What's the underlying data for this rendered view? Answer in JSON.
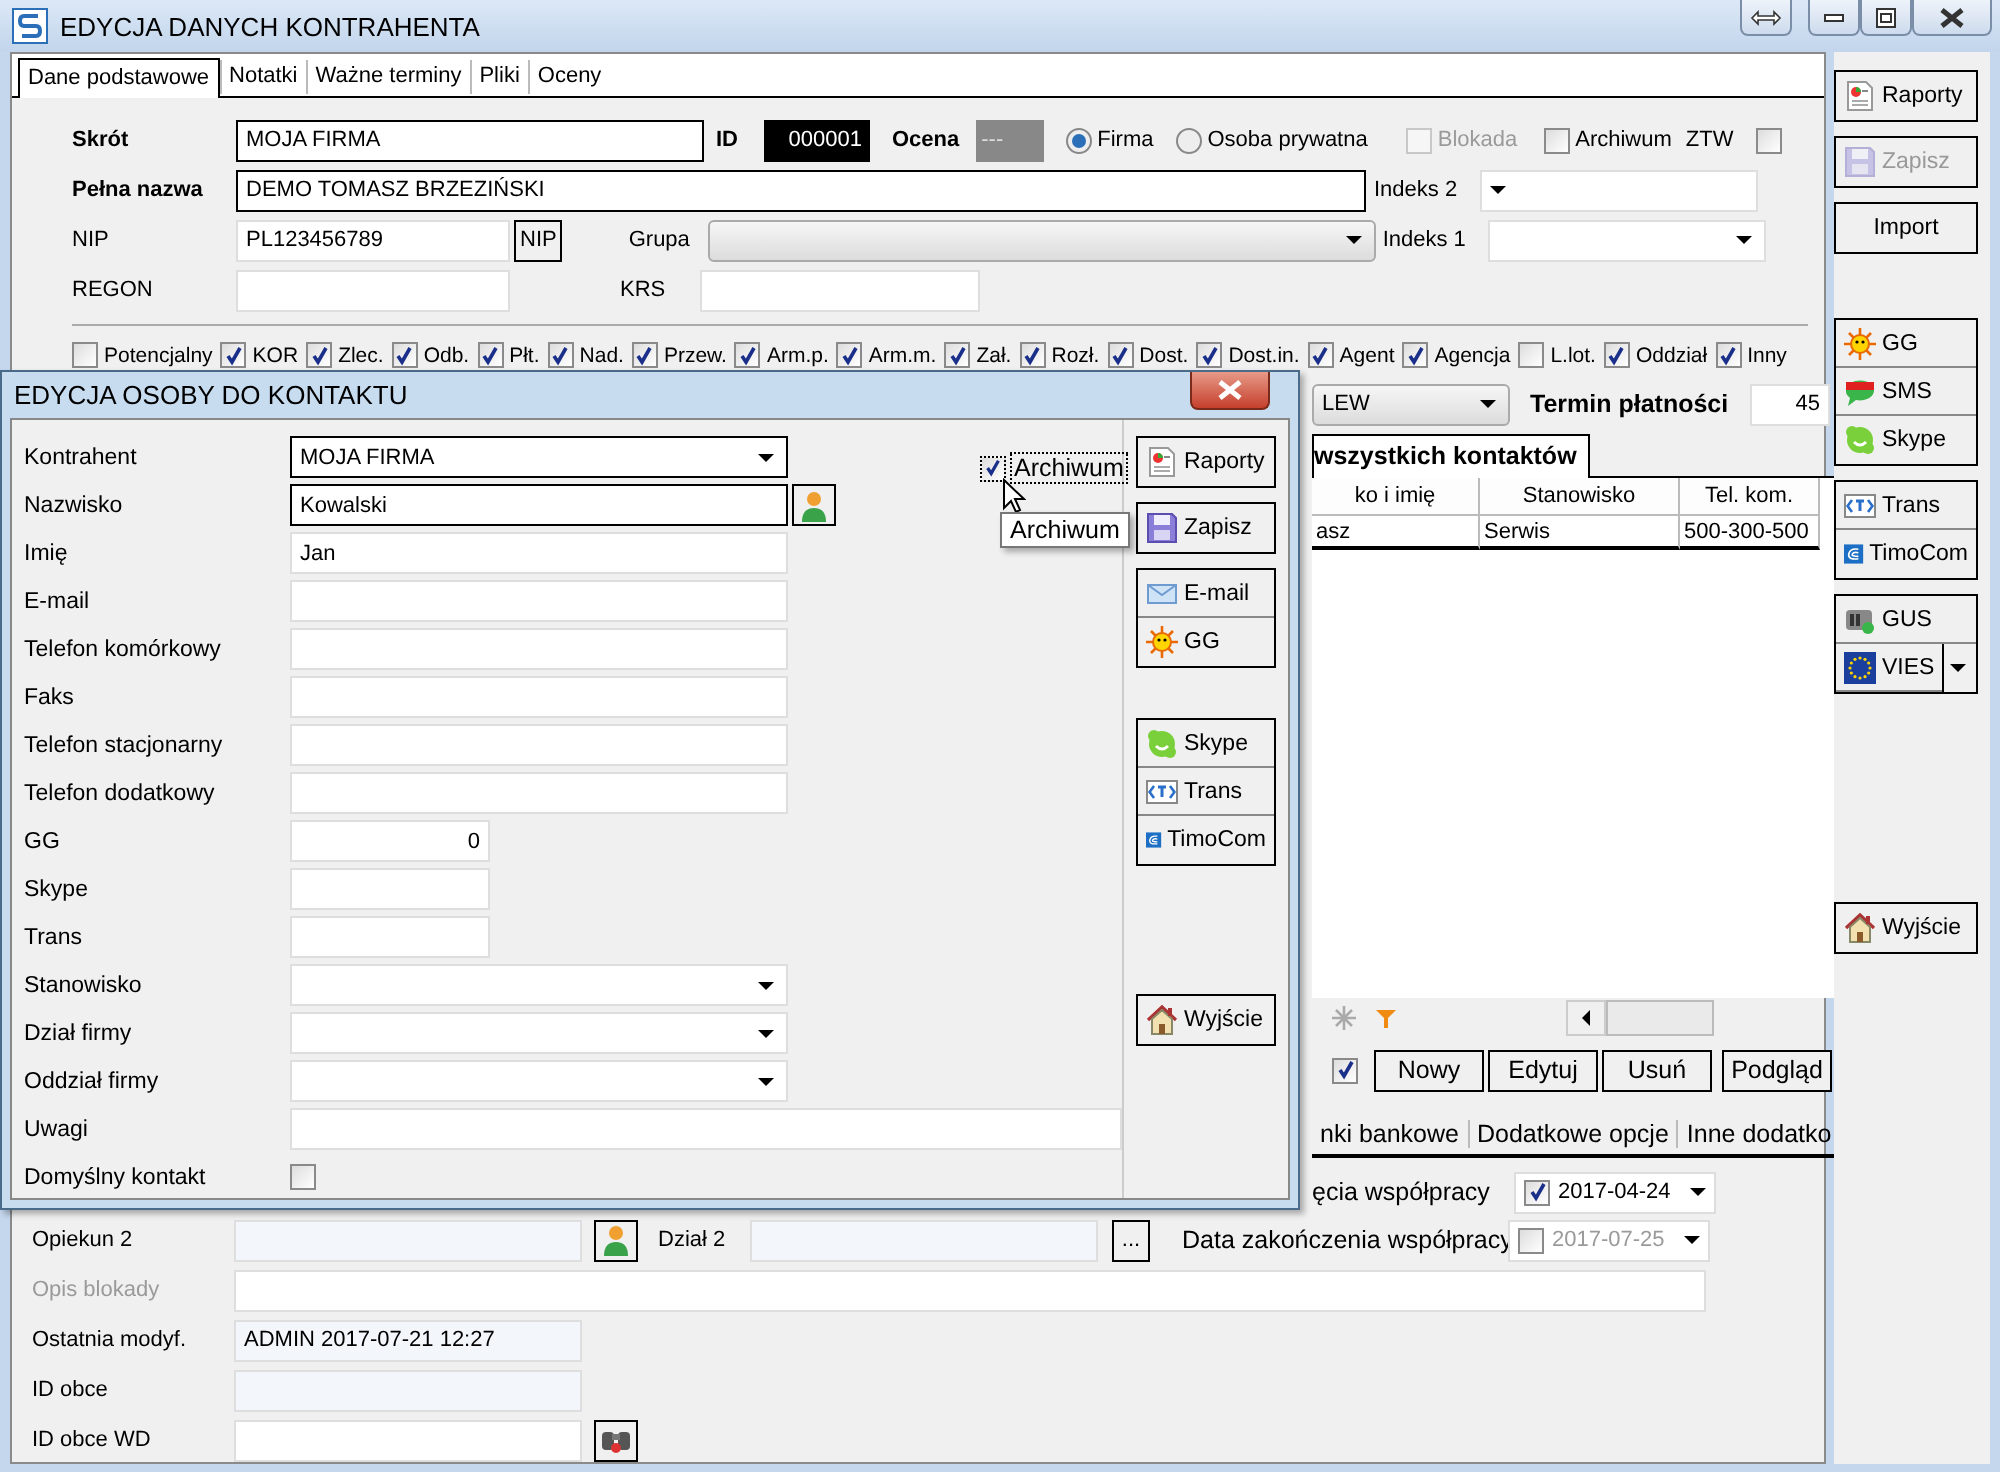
{
  "window": {
    "title": "EDYCJA DANYCH KONTRAHENTA"
  },
  "tabs": [
    {
      "label": "Dane podstawowe",
      "selected": true
    },
    {
      "label": "Notatki",
      "selected": false
    },
    {
      "label": "Ważne terminy",
      "selected": false
    },
    {
      "label": "Pliki",
      "selected": false
    },
    {
      "label": "Oceny",
      "selected": false
    }
  ],
  "header": {
    "short_name": {
      "label": "Skrót",
      "value": "MOJA FIRMA",
      "required": true
    },
    "id": {
      "label": "ID",
      "value": "000001"
    },
    "rating": {
      "label": "Ocena",
      "value": "---"
    },
    "entity_type": [
      {
        "label": "Firma",
        "selected": true
      },
      {
        "label": "Osoba prywatna",
        "selected": false
      }
    ],
    "flags": [
      {
        "label": "Blokada",
        "checked": false,
        "disabled": true
      },
      {
        "label": "Archiwum",
        "checked": false,
        "disabled": false
      }
    ],
    "ztw": {
      "label": "ZTW",
      "checked": false
    },
    "full_name": {
      "label": "Pełna nazwa",
      "value": "DEMO TOMASZ BRZEZIŃSKI",
      "required": true
    },
    "index2": {
      "label": "Indeks 2"
    },
    "nip": {
      "label": "NIP",
      "value": "PL123456789",
      "button": "NIP"
    },
    "group": {
      "label": "Grupa"
    },
    "index1": {
      "label": "Indeks 1"
    },
    "regon": {
      "label": "REGON"
    },
    "krs": {
      "label": "KRS"
    }
  },
  "roles": [
    {
      "label": "Potencjalny",
      "checked": false
    },
    {
      "label": "KOR",
      "checked": true
    },
    {
      "label": "Zlec.",
      "checked": true
    },
    {
      "label": "Odb.",
      "checked": true
    },
    {
      "label": "Płt.",
      "checked": true
    },
    {
      "label": "Nad.",
      "checked": true
    },
    {
      "label": "Przew.",
      "checked": true
    },
    {
      "label": "Arm.p.",
      "checked": true
    },
    {
      "label": "Arm.m.",
      "checked": true
    },
    {
      "label": "Zał.",
      "checked": true
    },
    {
      "label": "Rozł.",
      "checked": true
    },
    {
      "label": "Dost.",
      "checked": true
    },
    {
      "label": "Dost.in.",
      "checked": true
    },
    {
      "label": "Agent",
      "checked": true
    },
    {
      "label": "Agencja",
      "checked": true
    },
    {
      "label": "L.lot.",
      "checked": false
    },
    {
      "label": "Oddział",
      "checked": true
    },
    {
      "label": "Inny",
      "checked": true
    }
  ],
  "payment": {
    "method": "LEW",
    "term_label": "Termin płatności",
    "term": "45"
  },
  "contacts_tab": "wszystkich kontaktów",
  "contacts_table": {
    "columns": [
      "ko i imię",
      "Stanowisko",
      "Tel. kom."
    ],
    "rows": [
      [
        "asz",
        "Serwis",
        "500-300-500"
      ]
    ]
  },
  "contacts_filter": {
    "checked": true
  },
  "contact_buttons": [
    "Nowy",
    "Edytuj",
    "Usuń",
    "Podgląd"
  ],
  "lower_tabs": [
    "nki bankowe",
    "Dodatkowe opcje",
    "Inne dodatko"
  ],
  "dates": [
    {
      "label": "ęcia współpracy",
      "checked": true,
      "value": "2017-04-24"
    },
    {
      "label": "Data zakończenia współpracy",
      "checked": false,
      "value": "2017-07-25"
    }
  ],
  "bottom": {
    "guardian2": {
      "label": "Opiekun 2"
    },
    "department2": {
      "label": "Dział 2",
      "button": "..."
    },
    "block_note": {
      "label": "Opis blokady",
      "disabled": true
    },
    "last_modified": {
      "label": "Ostatnia modyf.",
      "value": "ADMIN 2017-07-21 12:27"
    },
    "foreign_id": {
      "label": "ID obce"
    },
    "foreign_id_wd": {
      "label": "ID obce WD"
    }
  },
  "toolbar": [
    {
      "buttons": [
        {
          "kind": "report",
          "label": "Raporty",
          "disabled": false
        }
      ]
    },
    {
      "buttons": [
        {
          "kind": "save",
          "label": "Zapisz",
          "disabled": true
        }
      ]
    },
    {
      "buttons": [
        {
          "kind": "plain",
          "label": "Import",
          "disabled": false
        }
      ]
    },
    {
      "buttons": [
        {
          "kind": "gg",
          "label": "GG",
          "disabled": false
        },
        {
          "kind": "sms",
          "label": "SMS",
          "disabled": false
        },
        {
          "kind": "skype",
          "label": "Skype",
          "disabled": false
        }
      ]
    },
    {
      "buttons": [
        {
          "kind": "trans",
          "label": "Trans",
          "disabled": false
        },
        {
          "kind": "timocom",
          "label": "TimoCom",
          "disabled": false
        }
      ]
    },
    {
      "buttons": [
        {
          "kind": "gus",
          "label": "GUS",
          "disabled": false
        },
        {
          "kind": "vies",
          "label": "VIES",
          "disabled": false,
          "dropdown": true
        }
      ]
    },
    {
      "buttons": [
        {
          "kind": "exit",
          "label": "Wyjście",
          "disabled": false
        }
      ]
    }
  ],
  "dialog": {
    "title": "EDYCJA OSOBY DO KONTAKTU",
    "fields": [
      {
        "label": "Kontrahent",
        "kind": "combo",
        "value": "MOJA FIRMA",
        "required": true,
        "picker": false
      },
      {
        "label": "Nazwisko",
        "kind": "text",
        "value": "Kowalski",
        "required": true,
        "picker": true
      },
      {
        "label": "Imię",
        "kind": "text",
        "value": "Jan",
        "required": false,
        "picker": false
      },
      {
        "label": "E-mail",
        "kind": "text",
        "required": false,
        "picker": false
      },
      {
        "label": "Telefon komórkowy",
        "kind": "text",
        "required": false,
        "picker": false
      },
      {
        "label": "Faks",
        "kind": "text",
        "required": false,
        "picker": false
      },
      {
        "label": "Telefon stacjonarny",
        "kind": "text",
        "required": false,
        "picker": false
      },
      {
        "label": "Telefon dodatkowy",
        "kind": "text",
        "required": false,
        "picker": false
      },
      {
        "label": "GG",
        "kind": "number",
        "value": "0",
        "picker": false
      },
      {
        "label": "Skype",
        "kind": "short",
        "picker": false
      },
      {
        "label": "Trans",
        "kind": "short",
        "picker": false
      },
      {
        "label": "Stanowisko",
        "kind": "combo",
        "required": false,
        "picker": false
      },
      {
        "label": "Dział firmy",
        "kind": "combo",
        "required": false,
        "picker": false
      },
      {
        "label": "Oddział firmy",
        "kind": "combo",
        "required": false,
        "picker": false
      },
      {
        "label": "Uwagi",
        "kind": "wide"
      },
      {
        "label": "Domyślny kontakt",
        "kind": "check",
        "checked": false,
        "picker": false
      }
    ],
    "archive": {
      "label": "Archiwum",
      "checked": true
    },
    "tooltip": "Archiwum",
    "buttons": [
      {
        "buttons": [
          {
            "kind": "report",
            "label": "Raporty",
            "disabled": false
          }
        ]
      },
      {
        "buttons": [
          {
            "kind": "save",
            "label": "Zapisz",
            "disabled": false
          }
        ]
      },
      {
        "buttons": [
          {
            "kind": "email",
            "label": "E-mail",
            "disabled": false
          },
          {
            "kind": "gg",
            "label": "GG",
            "disabled": false
          }
        ]
      },
      {
        "buttons": [
          {
            "kind": "skype",
            "label": "Skype",
            "disabled": false
          },
          {
            "kind": "trans",
            "label": "Trans",
            "disabled": false
          },
          {
            "kind": "timocom",
            "label": "TimoCom",
            "disabled": false
          }
        ]
      },
      {
        "buttons": [
          {
            "kind": "exit",
            "label": "Wyjście",
            "disabled": false
          }
        ]
      }
    ]
  }
}
